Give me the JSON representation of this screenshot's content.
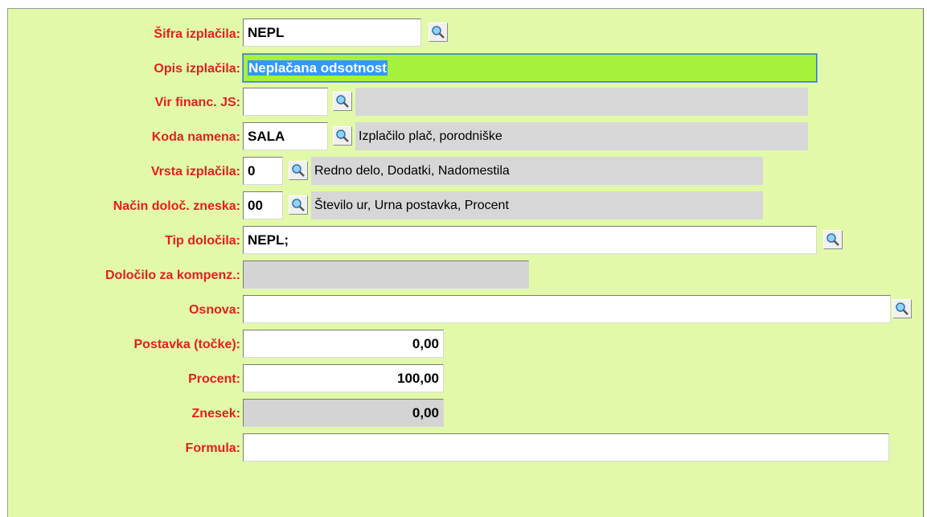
{
  "form": {
    "sifra": {
      "label": "Šifra izplačila:",
      "value": "NEPL"
    },
    "opis": {
      "label": "Opis izplačila:",
      "value": "Neplačana odsotnost"
    },
    "vir": {
      "label": "Vir financ. JS:",
      "value": "",
      "desc": ""
    },
    "koda": {
      "label": "Koda namena:",
      "value": "SALA",
      "desc": "Izplačilo plač, porodniške"
    },
    "vrsta": {
      "label": "Vrsta izplačila:",
      "value": "0",
      "desc": "Redno delo, Dodatki, Nadomestila"
    },
    "nacin": {
      "label": "Način določ. zneska:",
      "value": "00",
      "desc": "Število ur, Urna postavka, Procent"
    },
    "tip": {
      "label": "Tip določila:",
      "value": "NEPL;"
    },
    "dolocilo": {
      "label": "Določilo za kompenz.:",
      "value": ""
    },
    "osnova": {
      "label": "Osnova:",
      "value": ""
    },
    "postavka": {
      "label": "Postavka (točke):",
      "value": "0,00"
    },
    "procent": {
      "label": "Procent:",
      "value": "100,00"
    },
    "znesek": {
      "label": "Znesek:",
      "value": "0,00"
    },
    "formula": {
      "label": "Formula:",
      "value": ""
    }
  },
  "icons": {
    "lookup": "magnifier-icon"
  },
  "colors": {
    "panel_bg": "#e2f9a9",
    "label": "#e51e1e",
    "active_field": "#a6f13b",
    "selection": "#3399ff",
    "readonly": "#d4d4d4"
  }
}
